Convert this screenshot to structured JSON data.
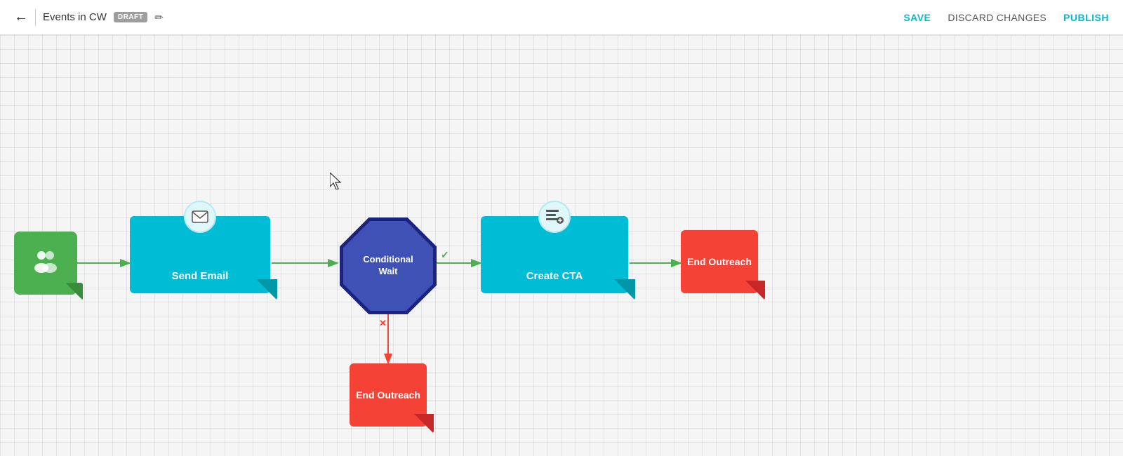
{
  "header": {
    "back_label": "←",
    "title": "Events in CW",
    "draft_badge": "DRAFT",
    "edit_icon": "✏",
    "save_label": "SAVE",
    "discard_label": "DISCARD CHANGES",
    "publish_label": "PUBLISH"
  },
  "nodes": {
    "start": {
      "icon": "👥"
    },
    "send_email": {
      "label": "Send Email",
      "icon": "✉"
    },
    "conditional_wait": {
      "label": "Conditional\nWait"
    },
    "create_cta": {
      "label": "Create CTA",
      "icon": "☰+"
    },
    "end_outreach_right": {
      "label": "End\nOutreach"
    },
    "end_outreach_bottom": {
      "label": "End\nOutreach"
    }
  }
}
